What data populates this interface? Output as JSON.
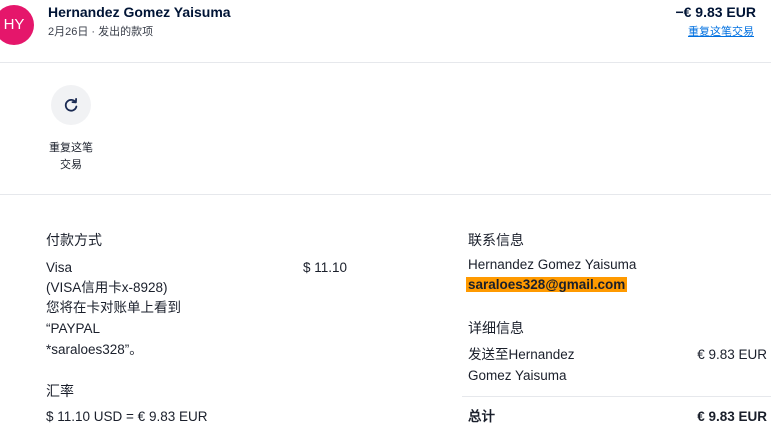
{
  "header": {
    "avatar_initials": "HY",
    "name": "Hernandez Gomez Yaisuma",
    "subtitle": "2月26日 · 发出的款项",
    "amount": "−€ 9.83 EUR",
    "repeat_link": "重复这笔交易"
  },
  "actions": {
    "repeat_label": "重复这笔交易",
    "icon": "refresh-icon"
  },
  "payment": {
    "title": "付款方式",
    "method_line1": "Visa",
    "method_line2": "(VISA信用卡x-8928)",
    "method_line3": "您将在卡对账单上看到",
    "method_line4": "“PAYPAL",
    "method_line5": "*saraloes328”。",
    "amount": "$ 11.10"
  },
  "exchange": {
    "title": "汇率",
    "value": "$ 11.10 USD = € 9.83 EUR"
  },
  "contact": {
    "title": "联系信息",
    "name": "Hernandez Gomez Yaisuma",
    "email": "saraloes328@gmail.com"
  },
  "details": {
    "title": "详细信息",
    "sent_to_line1": "发送至Hernandez",
    "sent_to_line2": "Gomez Yaisuma",
    "sent_amount": "€ 9.83 EUR",
    "total_label": "总计",
    "total_amount": "€ 9.83 EUR"
  },
  "colors": {
    "avatar": "#e5166b",
    "link": "#0070e0",
    "highlight": "#ff9a00"
  }
}
